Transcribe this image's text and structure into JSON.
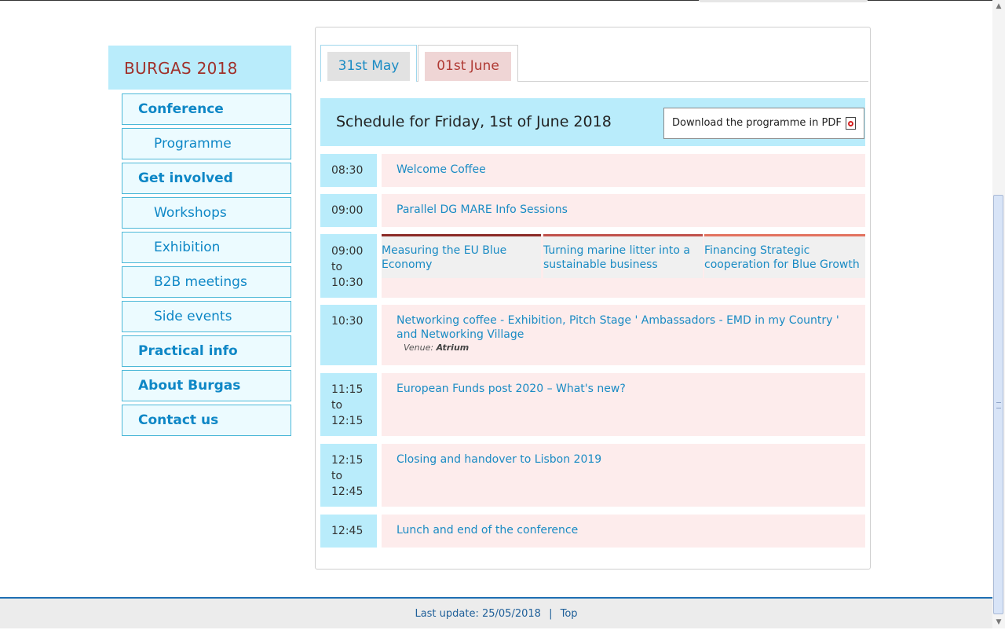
{
  "sidebar": {
    "title": "BURGAS 2018",
    "items": [
      {
        "label": "Conference"
      },
      {
        "label": "Programme"
      },
      {
        "label": "Get involved"
      },
      {
        "label": "Workshops"
      },
      {
        "label": "Exhibition"
      },
      {
        "label": "B2B meetings"
      },
      {
        "label": "Side events"
      },
      {
        "label": "Practical info"
      },
      {
        "label": "About Burgas"
      },
      {
        "label": "Contact us"
      }
    ]
  },
  "tabs": [
    {
      "label": "31st May"
    },
    {
      "label": "01st June"
    }
  ],
  "schedule": {
    "title": "Schedule for Friday, 1st of June 2018",
    "download_label": "Download the programme in PDF",
    "rows": [
      {
        "time": [
          "08:30"
        ],
        "title": "Welcome Coffee"
      },
      {
        "time": [
          "09:00"
        ],
        "title": "Parallel DG MARE Info Sessions"
      },
      {
        "time": [
          "09:00",
          "to",
          "10:30"
        ],
        "parallel": [
          {
            "title": "Measuring the EU Blue Economy",
            "color": "#8b2a26"
          },
          {
            "title": "Turning marine litter into a sustainable business",
            "color": "#c0514b"
          },
          {
            "title": "Financing Strategic cooperation for Blue Growth",
            "color": "#e2725f"
          }
        ]
      },
      {
        "time": [
          "10:30"
        ],
        "title": "Networking coffee - Exhibition, Pitch Stage ' Ambassadors - EMD in my Country ' and Networking Village",
        "venue_label": "Venue:",
        "venue": "Atrium"
      },
      {
        "time": [
          "11:15",
          "to",
          "12:15"
        ],
        "title": "European Funds post 2020 – What's new?"
      },
      {
        "time": [
          "12:15",
          "to",
          "12:45"
        ],
        "title": "Closing and handover to Lisbon 2019"
      },
      {
        "time": [
          "12:45"
        ],
        "title": "Lunch and end of the conference"
      }
    ]
  },
  "footer": {
    "last_update": "Last update: 25/05/2018",
    "separator": "|",
    "top_link": "Top"
  },
  "colors": {
    "accent_blue": "#1a8bc4",
    "light_blue": "#b9ecfb",
    "event_pink": "#fdecec",
    "brand_red": "#a0302a"
  }
}
